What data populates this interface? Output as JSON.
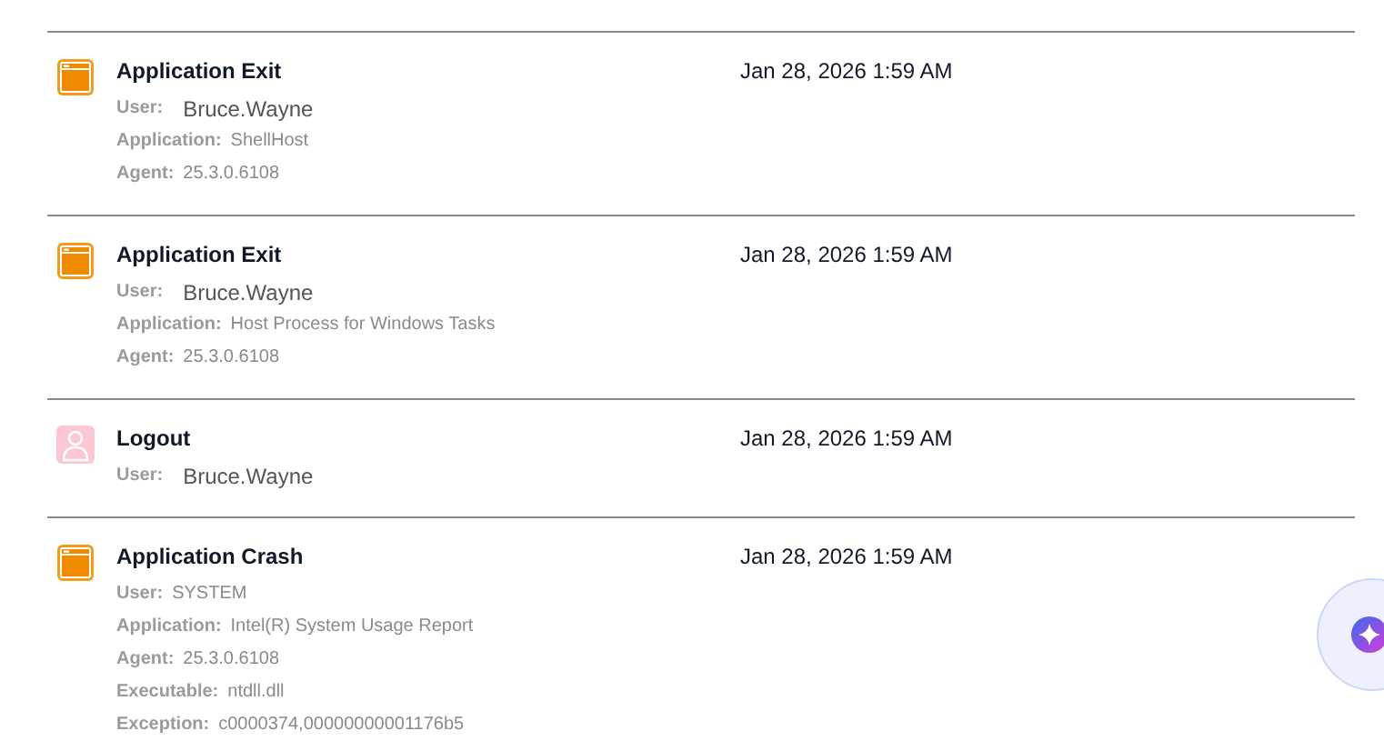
{
  "events": [
    {
      "kind": "app",
      "title": "Application Exit",
      "time": "Jan 28, 2026 1:59 AM",
      "details": [
        {
          "label": "User:",
          "value": "Bruce.Wayne",
          "large": true
        },
        {
          "label": "Application:",
          "value": "ShellHost",
          "large": false
        },
        {
          "label": "Agent:",
          "value": "25.3.0.6108",
          "large": false
        }
      ]
    },
    {
      "kind": "app",
      "title": "Application Exit",
      "time": "Jan 28, 2026 1:59 AM",
      "details": [
        {
          "label": "User:",
          "value": "Bruce.Wayne",
          "large": true
        },
        {
          "label": "Application:",
          "value": "Host Process for Windows Tasks",
          "large": false
        },
        {
          "label": "Agent:",
          "value": "25.3.0.6108",
          "large": false
        }
      ]
    },
    {
      "kind": "user",
      "title": "Logout",
      "time": "Jan 28, 2026 1:59 AM",
      "details": [
        {
          "label": "User:",
          "value": "Bruce.Wayne",
          "large": true
        }
      ]
    },
    {
      "kind": "app",
      "title": "Application Crash",
      "time": "Jan 28, 2026 1:59 AM",
      "details": [
        {
          "label": "User:",
          "value": "SYSTEM",
          "large": false
        },
        {
          "label": "Application:",
          "value": "Intel(R) System Usage Report",
          "large": false
        },
        {
          "label": "Agent:",
          "value": "25.3.0.6108",
          "large": false
        },
        {
          "label": "Executable:",
          "value": "ntdll.dll",
          "large": false
        },
        {
          "label": "Exception:",
          "value": "c0000374,00000000001176b5",
          "large": false
        }
      ]
    }
  ]
}
